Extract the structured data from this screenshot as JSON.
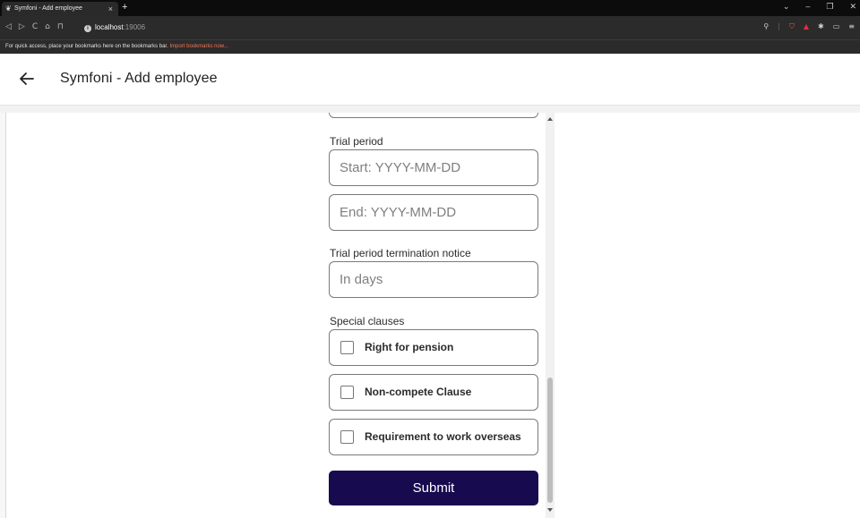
{
  "browser": {
    "tab_title": "Symfoni - Add employee",
    "tab_close": "×",
    "new_tab": "+",
    "window_controls": [
      "⌄",
      "–",
      "❐",
      "✕"
    ],
    "nav": [
      "◁",
      "▷",
      "C",
      "⌂",
      "⊓"
    ],
    "url_host": "localhost",
    "url_port": ":19006",
    "bookmarks_text": "For quick access, place your bookmarks here on the bookmarks bar.",
    "bookmarks_link": "Import bookmarks now..."
  },
  "header": {
    "title": "Symfoni - Add employee"
  },
  "form": {
    "trial_period_label": "Trial period",
    "start_placeholder": "Start: YYYY-MM-DD",
    "end_placeholder": "End: YYYY-MM-DD",
    "termination_label": "Trial period termination notice",
    "termination_placeholder": "In days",
    "special_clauses_label": "Special clauses",
    "clauses": [
      {
        "label": "Right for pension",
        "checked": false
      },
      {
        "label": "Non-compete Clause",
        "checked": false
      },
      {
        "label": "Requirement to work overseas",
        "checked": false
      }
    ],
    "submit_label": "Submit"
  },
  "colors": {
    "submit_bg": "#180a4f",
    "border": "#7a7a7a",
    "placeholder": "#7f7f7f"
  }
}
